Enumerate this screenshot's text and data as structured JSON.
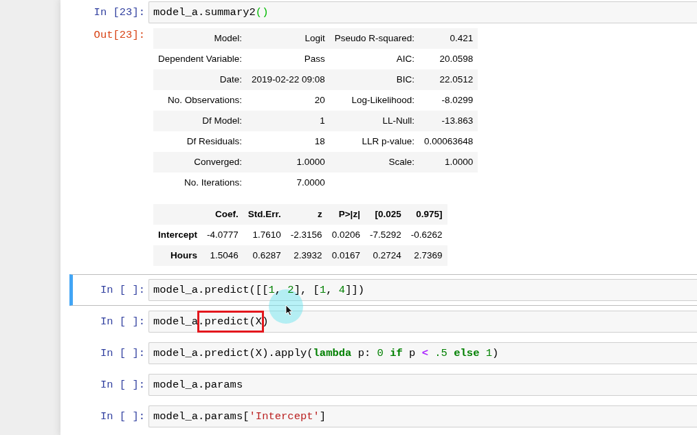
{
  "cells": [
    {
      "prompt": "In [23]:",
      "selected": false,
      "code": [
        {
          "text": "model_a.summary2",
          "kind": "plain"
        },
        {
          "text": "()",
          "kind": "matched-bracket"
        }
      ],
      "output": {
        "prompt": "Out[23]:",
        "summary_table": {
          "rows": [
            [
              "Model:",
              "Logit",
              "Pseudo R-squared:",
              "0.421"
            ],
            [
              "Dependent Variable:",
              "Pass",
              "AIC:",
              "20.0598"
            ],
            [
              "Date:",
              "2019-02-22 09:08",
              "BIC:",
              "22.0512"
            ],
            [
              "No. Observations:",
              "20",
              "Log-Likelihood:",
              "-8.0299"
            ],
            [
              "Df Model:",
              "1",
              "LL-Null:",
              "-13.863"
            ],
            [
              "Df Residuals:",
              "18",
              "LLR p-value:",
              "0.00063648"
            ],
            [
              "Converged:",
              "1.0000",
              "Scale:",
              "1.0000"
            ],
            [
              "No. Iterations:",
              "7.0000"
            ]
          ]
        },
        "coef_table": {
          "columns": [
            "Coef.",
            "Std.Err.",
            "z",
            "P>|z|",
            "[0.025",
            "0.975]"
          ],
          "rows": [
            {
              "label": "Intercept",
              "values": [
                "-4.0777",
                "1.7610",
                "-2.3156",
                "0.0206",
                "-7.5292",
                "-0.6262"
              ]
            },
            {
              "label": "Hours",
              "values": [
                "1.5046",
                "0.6287",
                "2.3932",
                "0.0167",
                "0.2724",
                "2.7369"
              ]
            }
          ]
        }
      }
    },
    {
      "prompt": "In [ ]:",
      "selected": true,
      "code": [
        {
          "text": "model_a.predict([[",
          "kind": "plain"
        },
        {
          "text": "1",
          "kind": "number"
        },
        {
          "text": ", ",
          "kind": "plain"
        },
        {
          "text": "2",
          "kind": "number"
        },
        {
          "text": "], [",
          "kind": "plain"
        },
        {
          "text": "1",
          "kind": "number"
        },
        {
          "text": ", ",
          "kind": "plain"
        },
        {
          "text": "4",
          "kind": "number"
        },
        {
          "text": "]])",
          "kind": "plain"
        }
      ]
    },
    {
      "prompt": "In [ ]:",
      "selected": false,
      "code": [
        {
          "text": "model_a.predict(X)",
          "kind": "plain"
        }
      ],
      "overlays": [
        {
          "kind": "rectangle"
        }
      ]
    },
    {
      "prompt": "In [ ]:",
      "selected": false,
      "code": [
        {
          "text": "model_a.predict(X).apply(",
          "kind": "plain"
        },
        {
          "text": "lambda",
          "kind": "keyword"
        },
        {
          "text": " p: ",
          "kind": "plain"
        },
        {
          "text": "0",
          "kind": "number"
        },
        {
          "text": " if",
          "kind": "keyword"
        },
        {
          "text": " p ",
          "kind": "plain"
        },
        {
          "text": "<",
          "kind": "operator"
        },
        {
          "text": " .5",
          "kind": "number"
        },
        {
          "text": " else",
          "kind": "keyword"
        },
        {
          "text": " 1",
          "kind": "number"
        },
        {
          "text": ")",
          "kind": "plain"
        }
      ]
    },
    {
      "prompt": "In [ ]:",
      "selected": false,
      "code": [
        {
          "text": "model_a.params",
          "kind": "plain"
        }
      ]
    },
    {
      "prompt": "In [ ]:",
      "selected": false,
      "code": [
        {
          "text": "model_a.params[",
          "kind": "plain"
        },
        {
          "text": "'Intercept'",
          "kind": "string"
        },
        {
          "text": "]",
          "kind": "plain"
        }
      ]
    }
  ],
  "mouse_pointer": {
    "clicking": true
  }
}
